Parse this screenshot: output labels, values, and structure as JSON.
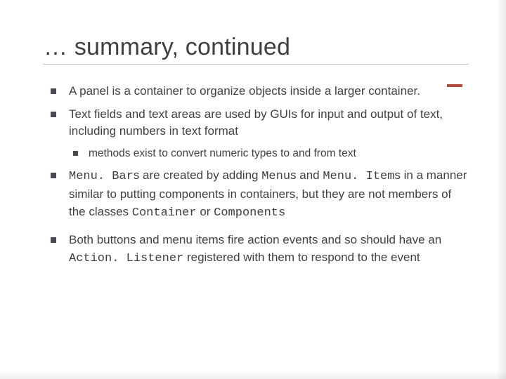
{
  "title": "… summary, continued",
  "bullets": {
    "b1": "A panel is a container to organize objects inside a larger container.",
    "b2": "Text fields and text areas are used by GUIs for input and output of text, including numbers in text format",
    "b2a": "methods exist to convert numeric types to and from text",
    "b3": {
      "c1": "Menu. Bar",
      "t1": "s are created by adding ",
      "c2": "Menu",
      "t2": "s and ",
      "c3": "Menu. Item",
      "t3": "s in a manner similar to putting components in containers, but they are not members of the classes ",
      "c4": "Container",
      "t4": " or ",
      "c5": "Components"
    },
    "b4": {
      "t1": "Both buttons and menu items fire action events and so should have an ",
      "c1": "Action. Listener",
      "t2": " registered with them to respond to the event"
    }
  }
}
